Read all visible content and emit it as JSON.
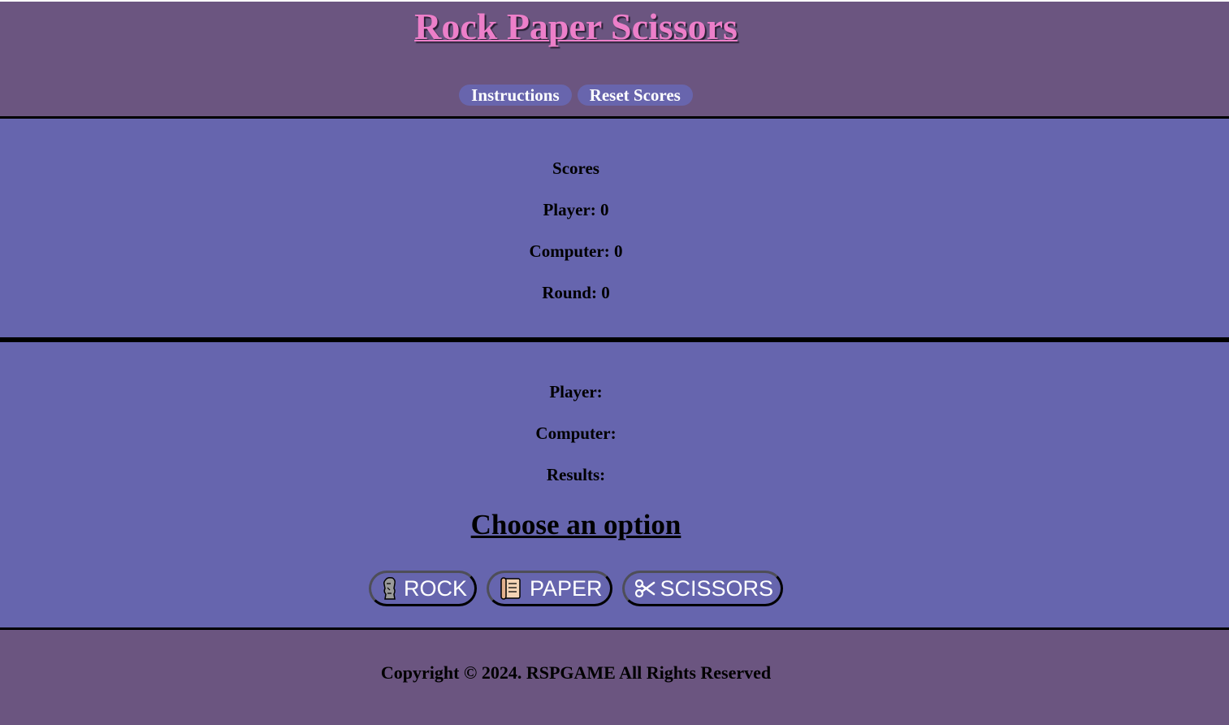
{
  "header": {
    "title": "Rock Paper Scissors",
    "nav": [
      {
        "label": "Instructions"
      },
      {
        "label": "Reset Scores"
      }
    ]
  },
  "scores": {
    "heading": "Scores",
    "player": "Player: 0",
    "computer": "Computer: 0",
    "round": "Round: 0"
  },
  "round": {
    "player": "Player:",
    "computer": "Computer:",
    "results": "Results:",
    "prompt": "Choose an option",
    "choices": [
      {
        "label": "ROCK",
        "icon": "moai-icon"
      },
      {
        "label": "PAPER",
        "icon": "scroll-icon"
      },
      {
        "label": "SCISSORS",
        "icon": "scissors-icon"
      }
    ]
  },
  "footer": {
    "copyright": "Copyright © 2024. RSPGAME All Rights Reserved"
  },
  "colors": {
    "header_bg": "#6b5580",
    "panel_bg": "#6665ae",
    "title": "#ec7fc9",
    "button_bg": "#6865ad"
  }
}
